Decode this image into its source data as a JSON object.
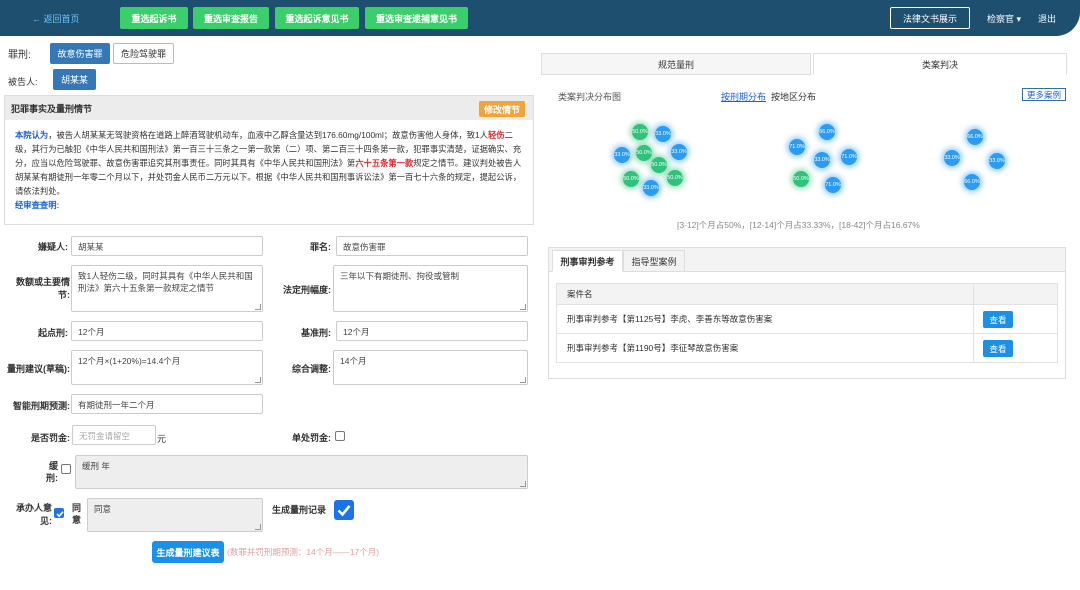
{
  "topbar": {
    "back_label": "← 返回首页",
    "buttons": [
      "重选起诉书",
      "重选审查报告",
      "重选起诉意见书",
      "重选审查逮捕意见书"
    ],
    "legal_docs_label": "法律文书展示",
    "officer_label": "检察官 ▾",
    "logout_label": "退出"
  },
  "crime": {
    "label": "罪刑:",
    "options": [
      "故意伤害罪",
      "危险驾驶罪"
    ]
  },
  "defendant": {
    "label": "被告人:",
    "name": "胡某某"
  },
  "facts": {
    "title": "犯罪事实及量刑情节",
    "modify_label": "修改情节",
    "p1_lead": "本院认为",
    "p1_a": "，被告人胡某某无驾驶资格在道路上醉酒驾驶机动车，血液中乙醇含量达到176.60mg/100ml；故意伤害他人身体，致1人",
    "p1_red1": "轻伤",
    "p1_b": "二级，其行为已触犯《中华人民共和国刑法》第一百三十三条之一第一款第（二）项、第二百三十四条第一款，犯罪事实清楚，证据确实、充分，应当以危险驾驶罪、故意伤害罪追究其刑事责任。同时其具有《中华人民共和国刑法》第",
    "p1_red2": "六十五条第一款",
    "p1_c": "规定之情节。建议判处被告人胡某某有期徒刑一年零二个月以下，并处罚金人民币二万元以下。根据《中华人民共和国刑事诉讼法》第一百七十六条的规定，提起公诉，请依法判处。",
    "review_label": "经审查查明:"
  },
  "form": {
    "suspect_label": "嫌疑人:",
    "suspect_value": "胡某某",
    "charge_label": "罪名:",
    "charge_value": "故意伤害罪",
    "amount_label": "数额或主要情节:",
    "amount_value": "致1人轻伤二级，同时其具有《中华人民共和国刑法》第六十五条第一款规定之情节",
    "statutory_label": "法定刑幅度:",
    "statutory_value": "三年以下有期徒刑、拘役或管制",
    "start_label": "起点刑:",
    "start_value": "12个月",
    "base_label": "基准刑:",
    "base_value": "12个月",
    "draft_label": "量刑建议(草稿):",
    "draft_value": "12个月×(1+20%)=14.4个月",
    "adjust_label": "综合调整:",
    "adjust_value": "14个月",
    "predict_label": "智能刑期预测:",
    "predict_value": "有期徒刑一年二个月",
    "fine_label": "是否罚金:",
    "fine_placeholder": "无罚金请留空",
    "fine_unit": "元",
    "single_fine_label": "单处罚金:",
    "probation_label": "缓刑:",
    "probation_value": "缓刑  年",
    "opinion_label": "承办人意见:",
    "opinion_check_label": "同意",
    "opinion_value": "同意",
    "record_label": "生成量刑记录",
    "generate_label": "生成量刑建议表",
    "generate_note": "(数罪并罚刑期预测：14个月——17个月)"
  },
  "right": {
    "tabs": [
      "规范量刑",
      "类案判决"
    ],
    "dist_title": "类案判决分布图",
    "by_term": "按刑期分布",
    "by_region": "按地区分布",
    "more_cases": "更多案例",
    "cluster1": [
      "50.0%",
      "33.0%",
      "33.0%",
      "50.0%",
      "50.0%",
      "50.0%",
      "33.0%",
      "50.0%",
      "33.0%"
    ],
    "cluster2": [
      "66.0%",
      "71.0%",
      "33.0%",
      "71.0%",
      "50.0%",
      "71.0%"
    ],
    "cluster3": [
      "66.0%",
      "33.0%",
      "33.0%",
      "66.0%"
    ],
    "dist_text": "[3-12]个月占50%，[12-14]个月占33.33%，[18-42]个月占16.67%",
    "ref_tabs": [
      "刑事审判参考",
      "指导型案例"
    ],
    "table_header": "案件名",
    "rows": [
      "刑事审判参考【第1125号】李虎、李善东等故意伤害案",
      "刑事审判参考【第1190号】李征琴故意伤害案"
    ],
    "view_label": "查看"
  },
  "colors": {
    "topbar": "#1e4f6f",
    "green_button": "#3bcf6b",
    "primary_blue": "#3478b7",
    "accent_orange": "#f2a33a"
  }
}
